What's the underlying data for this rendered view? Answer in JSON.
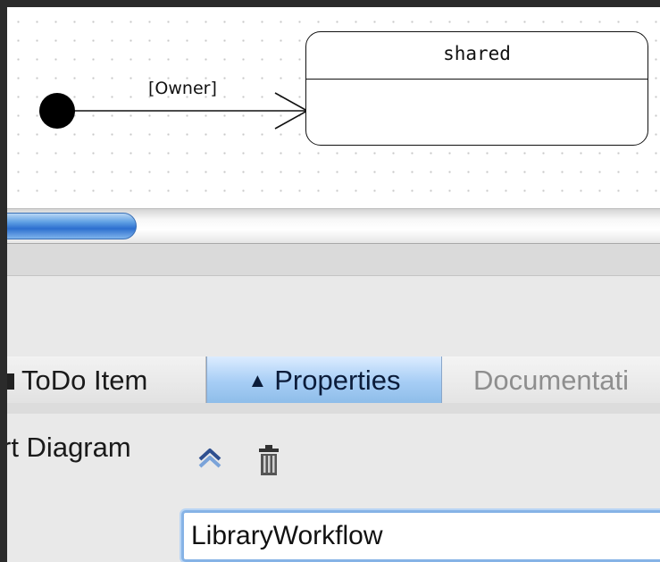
{
  "diagram": {
    "state_name": "shared",
    "transition_guard": "[Owner]"
  },
  "tabs": [
    {
      "label": "ToDo Item",
      "active": false
    },
    {
      "label": "Properties",
      "active": true
    },
    {
      "label": "Documentati",
      "active": false
    }
  ],
  "properties": {
    "element_type": "rt Diagram",
    "name_value": "LibraryWorkflow"
  },
  "colors": {
    "active_tab": "#a6cdf5",
    "scroll_thumb": "#2d6fcf",
    "field_focus": "#86b3e6"
  },
  "icons": [
    "navigate-up-icon",
    "delete-icon"
  ]
}
